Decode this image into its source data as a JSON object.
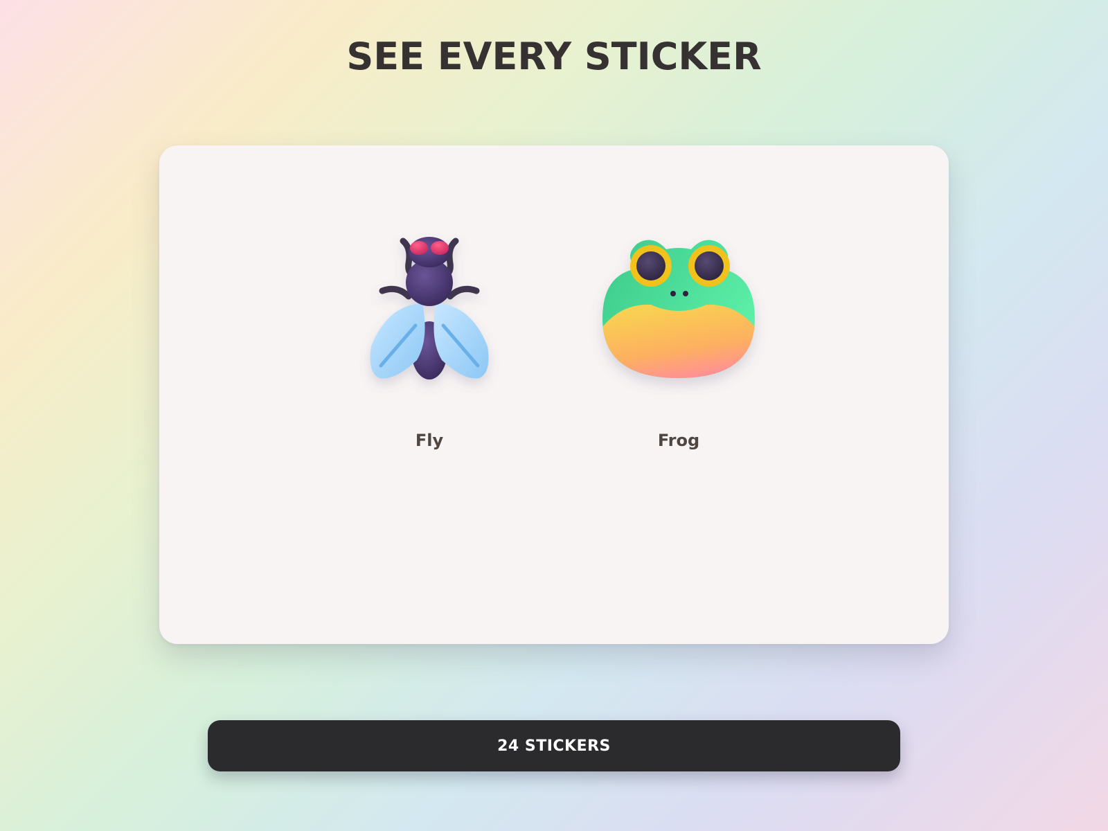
{
  "header": {
    "title": "SEE EVERY STICKER"
  },
  "stickers": [
    {
      "label": "Fly",
      "icon": "fly-icon"
    },
    {
      "label": "Frog",
      "icon": "frog-icon"
    }
  ],
  "footer": {
    "count_label": "24 STICKERS"
  },
  "colors": {
    "title": "#353231",
    "card": "#f8f4f4",
    "label": "#4f4541",
    "button": "#2b2b2d",
    "button_text": "#ffffff"
  }
}
